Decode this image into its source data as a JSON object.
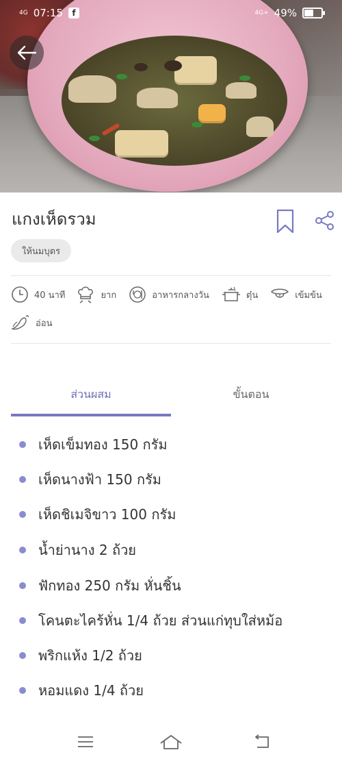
{
  "status_bar": {
    "network_left": "4G",
    "time": "07:15",
    "network_right": "4G+",
    "battery_percent": "49%",
    "battery_level": 0.49
  },
  "recipe": {
    "title": "แกงเห็ดรวม",
    "tag": "ให้นมบุตร",
    "meta": {
      "time": "40 นาที",
      "difficulty": "ยาก",
      "meal": "อาหารกลางวัน",
      "method": "ตุ๋น",
      "texture": "เข้มข้น",
      "spice": "อ่อน"
    }
  },
  "tabs": {
    "ingredients": "ส่วนผสม",
    "steps": "ขั้นตอน"
  },
  "ingredients": [
    "เห็ดเข็มทอง 150 กรัม",
    "เห็ดนางฟ้า 150 กรัม",
    "เห็ดชิเมจิขาว 100 กรัม",
    "น้ำย่านาง 2 ถ้วย",
    "ฟักทอง 250 กรัม หั่นชิ้น",
    "โคนตะไคร้หั่น 1/4 ถ้วย ส่วนแก่ทุบใส่หม้อ",
    "พริกแห้ง 1/2 ถ้วย",
    "หอมแดง 1/4 ถ้วย"
  ],
  "icons": {
    "back": "arrow-left-icon",
    "bookmark": "bookmark-icon",
    "share": "share-icon",
    "clock": "clock-icon",
    "chef": "chef-hat-icon",
    "meal": "plate-utensils-icon",
    "pot": "pot-icon",
    "tongue": "tongue-icon",
    "chili": "chili-icon",
    "menu": "menu-icon",
    "home": "home-icon",
    "return": "return-icon"
  },
  "colors": {
    "accent": "#7779c2",
    "bullet": "#8a8cd0",
    "tag_bg": "#eaeaea"
  }
}
